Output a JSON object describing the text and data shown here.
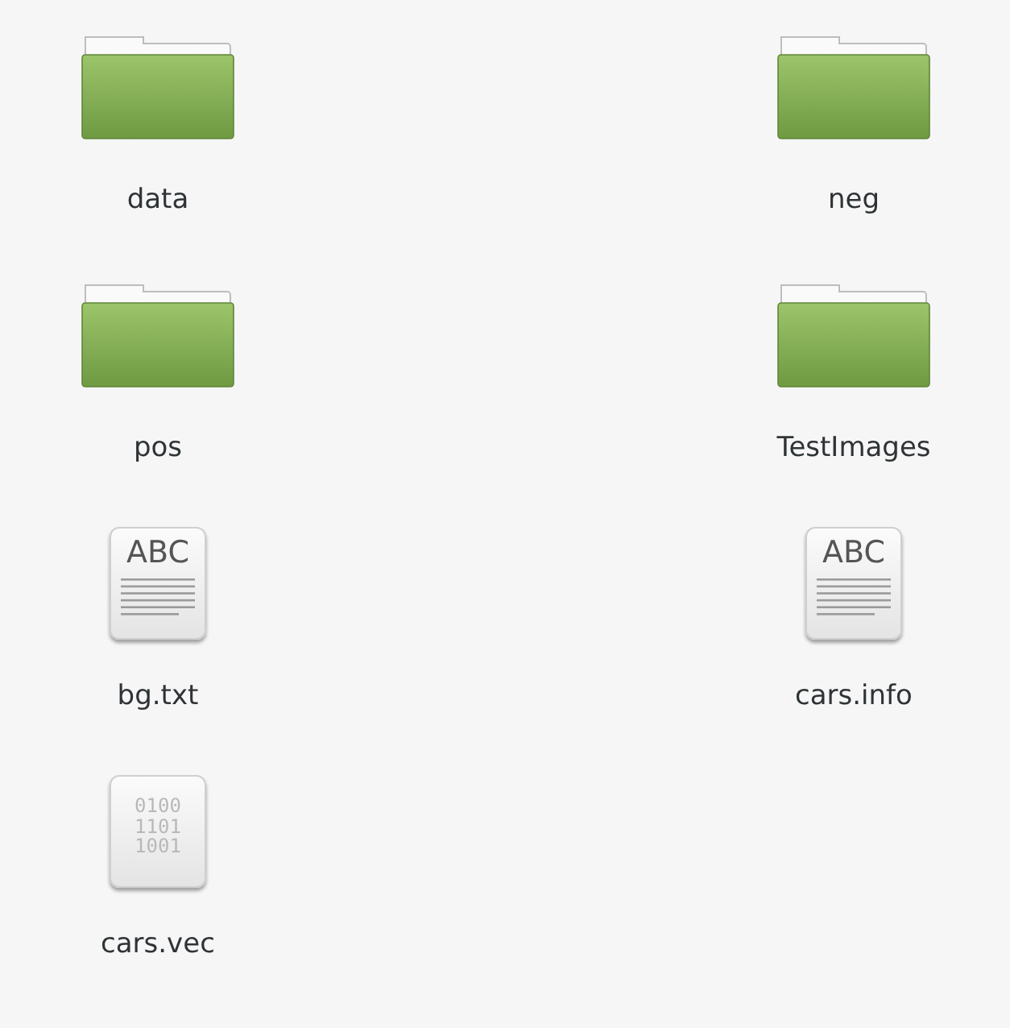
{
  "files": [
    {
      "name": "data",
      "kind": "folder"
    },
    {
      "name": "neg",
      "kind": "folder"
    },
    {
      "name": "pos",
      "kind": "folder"
    },
    {
      "name": "TestImages",
      "kind": "folder"
    },
    {
      "name": "bg.txt",
      "kind": "text",
      "icon_text": "ABC"
    },
    {
      "name": "cars.info",
      "kind": "text",
      "icon_text": "ABC"
    },
    {
      "name": "cars.vec",
      "kind": "binary",
      "icon_lines": [
        "0100",
        "1101",
        "1001"
      ]
    }
  ]
}
